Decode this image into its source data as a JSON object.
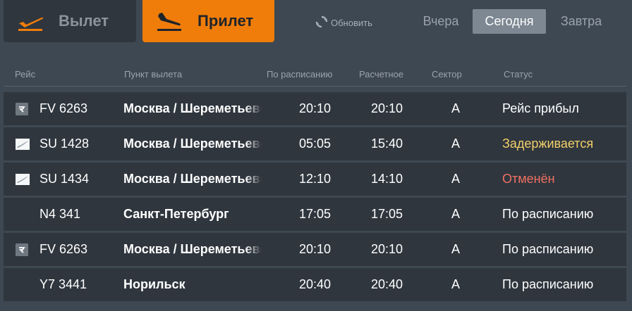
{
  "tabs": {
    "departure": "Вылет",
    "arrival": "Прилет"
  },
  "refresh_label": "Обновить",
  "days": {
    "yesterday": "Вчера",
    "today": "Сегодня",
    "tomorrow": "Завтра"
  },
  "columns": {
    "flight": "Рейс",
    "origin": "Пункт вылета",
    "scheduled": "По расписанию",
    "estimated": "Расчетное",
    "sector": "Сектор",
    "status": "Статус"
  },
  "colors": {
    "accent": "#f07d0a",
    "delayed": "#f2cf6a",
    "cancelled": "#ef7061",
    "row_bg": "#2f363e",
    "page_bg": "#3e4852"
  },
  "flights": [
    {
      "logo": "rossiya-logo-icon",
      "flight": "FV 6263",
      "origin": "Москва / Шереметьево",
      "scheduled": "20:10",
      "estimated": "20:10",
      "sector": "A",
      "status": "Рейс прибыл",
      "status_kind": "normal"
    },
    {
      "logo": "aeroflot-logo-icon",
      "flight": "SU 1428",
      "origin": "Москва / Шереметьево",
      "scheduled": "05:05",
      "estimated": "15:40",
      "sector": "A",
      "status": "Задерживается",
      "status_kind": "delayed"
    },
    {
      "logo": "aeroflot-logo-icon",
      "flight": "SU 1434",
      "origin": "Москва / Шереметьево",
      "scheduled": "12:10",
      "estimated": "14:10",
      "sector": "A",
      "status": "Отменён",
      "status_kind": "cancelled"
    },
    {
      "logo": "",
      "flight": "N4 341",
      "origin": "Санкт-Петербург",
      "scheduled": "17:05",
      "estimated": "17:05",
      "sector": "A",
      "status": "По расписанию",
      "status_kind": "normal"
    },
    {
      "logo": "rossiya-logo-icon",
      "flight": "FV 6263",
      "origin": "Москва / Шереметьево",
      "scheduled": "20:10",
      "estimated": "20:10",
      "sector": "A",
      "status": "По расписанию",
      "status_kind": "normal"
    },
    {
      "logo": "",
      "flight": "Y7 3441",
      "origin": "Норильск",
      "scheduled": "20:40",
      "estimated": "20:40",
      "sector": "A",
      "status": "По расписанию",
      "status_kind": "normal"
    }
  ]
}
